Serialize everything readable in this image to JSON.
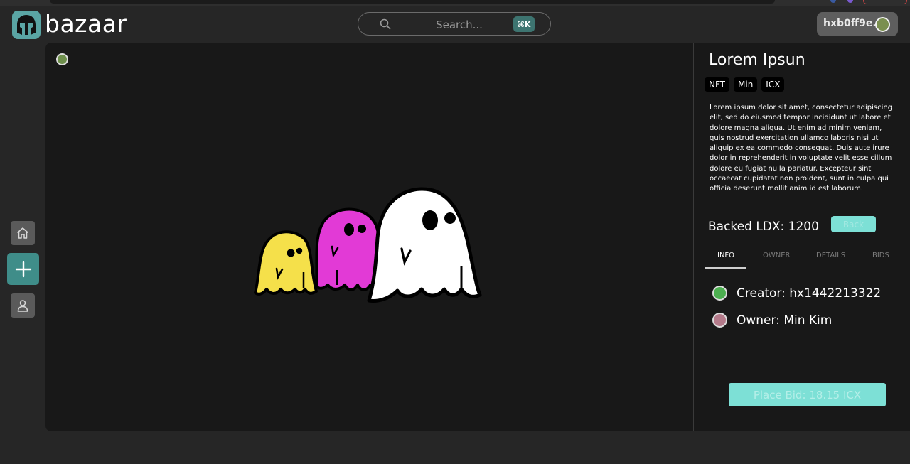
{
  "app": {
    "brand": "bazaar"
  },
  "header": {
    "search": {
      "placeholder": "Search...",
      "shortcut": "⌘K"
    },
    "wallet": {
      "address": "hxb0ff9e...",
      "avatar_color": "#7a8f4f"
    }
  },
  "sidebar": {
    "items": [
      "home-icon",
      "add-icon",
      "user-icon"
    ],
    "active": "add"
  },
  "nft": {
    "status_color": "#6e8f4c",
    "title": "Lorem Ipsun",
    "tags": [
      "NFT",
      "Min",
      "ICX"
    ],
    "description": "Lorem ipsum dolor sit amet, consectetur adipiscing elit, sed do eiusmod tempor incididunt ut labore et dolore magna aliqua. Ut enim ad minim veniam, quis nostrud exercitation ullamco laboris nisi ut aliquip ex ea commodo consequat. Duis aute irure dolor in reprehenderit in voluptate velit esse cillum dolore eu fugiat nulla pariatur. Excepteur sint occaecat cupidatat non proident, sunt in culpa qui officia deserunt mollit anim id est laborum.",
    "backed": "Backed LDX: 1200",
    "back_label": "Back",
    "tabs": [
      "INFO",
      "OWNER",
      "DETAILS",
      "BIDS"
    ],
    "active_tab": "INFO",
    "creator": {
      "text": "Creator: hx1442213322",
      "color": "#4caf50"
    },
    "owner": {
      "text": "Owner: Min Kim",
      "color": "#b47a8a"
    },
    "bid_label": "Place Bid: 18.15 ICX"
  },
  "colors": {
    "accent": "#3f8d89",
    "button": "#7de0d6",
    "bg": "#262626",
    "panel": "#181818"
  }
}
